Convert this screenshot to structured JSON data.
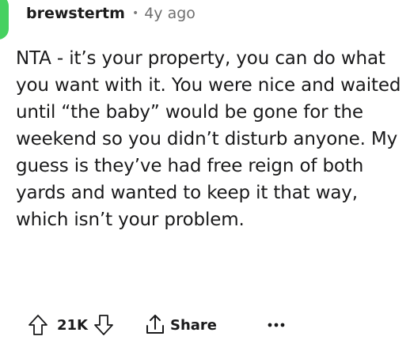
{
  "comment": {
    "author": "brewstertm",
    "separator": "•",
    "timestamp": "4y ago",
    "avatar_color": "#46d160",
    "body": "NTA - it’s your property, you can do what you want with it. You were nice and waited until “the baby” would be gone for the weekend so you didn’t disturb anyone. My guess is they’ve had free reign of both yards and wanted to keep it that way, which isn’t your problem."
  },
  "actions": {
    "upvote_icon": "arrow-up-icon",
    "score": "21K",
    "downvote_icon": "arrow-down-icon",
    "share_icon": "share-icon",
    "share_label": "Share",
    "more_icon": "more-options-icon"
  }
}
